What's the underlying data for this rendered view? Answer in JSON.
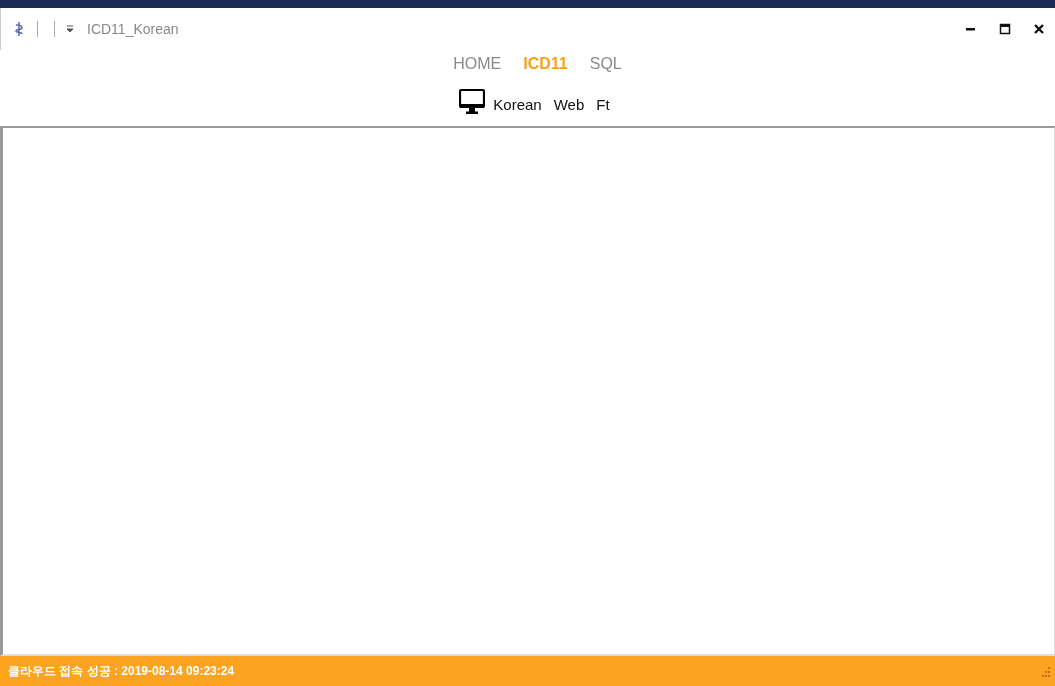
{
  "window": {
    "title": "ICD11_Korean"
  },
  "tabs": [
    {
      "label": "HOME",
      "selected": false
    },
    {
      "label": "ICD11",
      "selected": true
    },
    {
      "label": "SQL",
      "selected": false
    }
  ],
  "ribbon_items": [
    {
      "label": "Korean"
    },
    {
      "label": "Web"
    },
    {
      "label": "Ft"
    }
  ],
  "status_bar": {
    "text": "클라우드 접속 성공 : 2019-08-14 09:23:24"
  }
}
